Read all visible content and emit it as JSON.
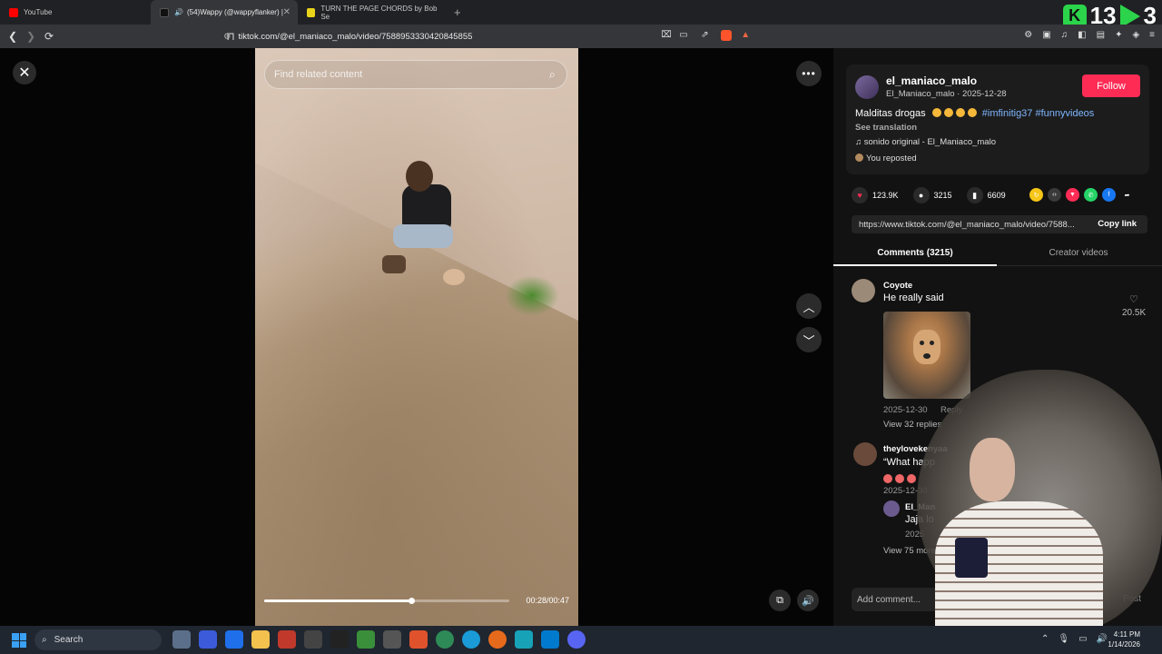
{
  "browser": {
    "tabs": [
      {
        "label": "YouTube"
      },
      {
        "label": "(54)Wappy (@wappyflanker) |"
      },
      {
        "label": "TURN THE PAGE CHORDS by Bob Se"
      }
    ],
    "url": "tiktok.com/@el_maniaco_malo/video/7588953330420845855"
  },
  "overlay": {
    "count_a": "13",
    "count_b": "3"
  },
  "video": {
    "search_placeholder": "Find related content",
    "timecode": "00:28/00:47",
    "progress_fraction": 0.6
  },
  "post": {
    "username": "el_maniaco_malo",
    "meta": "El_Maniaco_malo · 2025-12-28",
    "follow_label": "Follow",
    "caption_text": "Malditas drogas",
    "hashtags": "#imfinitig37 #funnyvideos",
    "see_translation": "See translation",
    "music": "sonido original - El_Maniaco_malo",
    "reposted": "You reposted",
    "likes": "123.9K",
    "comments": "3215",
    "saves": "6609",
    "link": "https://www.tiktok.com/@el_maniaco_malo/video/7588...",
    "copy_link": "Copy link"
  },
  "tabs": {
    "comments": "Comments (3215)",
    "creator_videos": "Creator videos"
  },
  "comments": [
    {
      "name": "Coyote",
      "text": "He really said",
      "date": "2025-12-30",
      "reply": "Reply",
      "likes": "20.5K",
      "view_replies": "View 32 replies"
    },
    {
      "name": "theylovekenyaa",
      "text": "“What happ",
      "date": "2025-12-30"
    },
    {
      "name": "El_Man",
      "text": "Jaja lo",
      "date": "2025"
    },
    {
      "view_replies": "View 75 more"
    }
  ],
  "add_comment": {
    "placeholder": "Add comment...",
    "post_label": "Post"
  },
  "taskbar": {
    "search_label": "Search",
    "time": "4:11 PM",
    "date": "1/14/2026"
  }
}
